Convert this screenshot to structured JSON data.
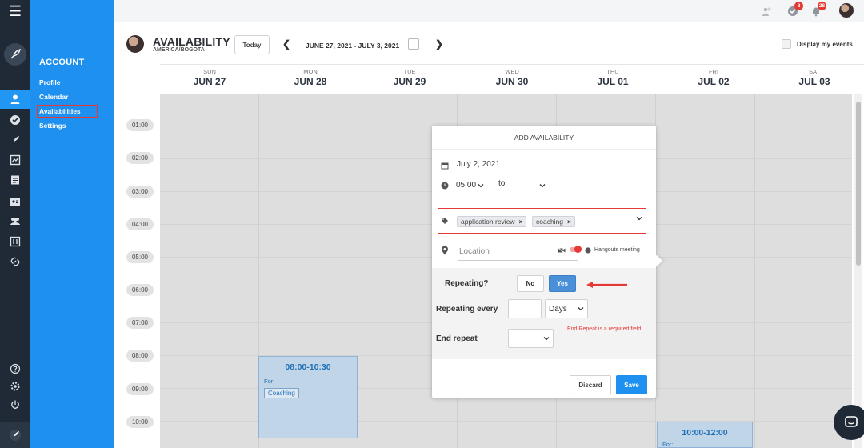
{
  "sidebar": {
    "heading": "ACCOUNT",
    "items": [
      {
        "label": "Profile"
      },
      {
        "label": "Calendar"
      },
      {
        "label": "Availabilities"
      },
      {
        "label": "Settings"
      }
    ]
  },
  "topbar": {
    "icons": [
      "users-icon",
      "check-icon",
      "bell-icon"
    ],
    "badges": {
      "check": "8",
      "bell": "28"
    }
  },
  "header": {
    "title": "AVAILABILITY",
    "timezone": "AMERICA/BOGOTA",
    "today_label": "Today",
    "range": "JUNE 27, 2021 - JULY 3, 2021",
    "display_events_label": "Display my events"
  },
  "days": [
    {
      "name": "SUN",
      "date": "JUN 27"
    },
    {
      "name": "MON",
      "date": "JUN 28"
    },
    {
      "name": "TUE",
      "date": "JUN 29"
    },
    {
      "name": "WED",
      "date": "JUN 30"
    },
    {
      "name": "THU",
      "date": "JUL 01"
    },
    {
      "name": "FRI",
      "date": "JUL 02"
    },
    {
      "name": "SAT",
      "date": "JUL 03"
    }
  ],
  "times": [
    "01:00",
    "02:00",
    "03:00",
    "04:00",
    "05:00",
    "06:00",
    "07:00",
    "08:00",
    "09:00",
    "10:00"
  ],
  "events": [
    {
      "time": "08:00-10:30",
      "for_label": "For:",
      "tag": "Coaching"
    },
    {
      "time": "10:00-12:00",
      "for_label": "For:"
    }
  ],
  "modal": {
    "title": "ADD AVAILABILITY",
    "date": "July 2, 2021",
    "start_time": "05:00",
    "to_label": "to",
    "end_time": "",
    "tags": [
      "application review",
      "coaching"
    ],
    "location_placeholder": "Location",
    "hangouts_label": "Hangouts meeting",
    "repeating_label": "Repeating?",
    "no_label": "No",
    "yes_label": "Yes",
    "repeating_every_label": "Repeating every",
    "repeat_count": "",
    "repeat_unit": "Days",
    "end_repeat_label": "End repeat",
    "end_repeat_value": "",
    "error": "End Repeat is a required field",
    "discard_label": "Discard",
    "save_label": "Save"
  },
  "colors": {
    "rail": "#1f2a36",
    "sidebar": "#1e90f0",
    "accent": "#1e90f0",
    "error": "#e53935",
    "yes_active": "#4a90d9"
  }
}
